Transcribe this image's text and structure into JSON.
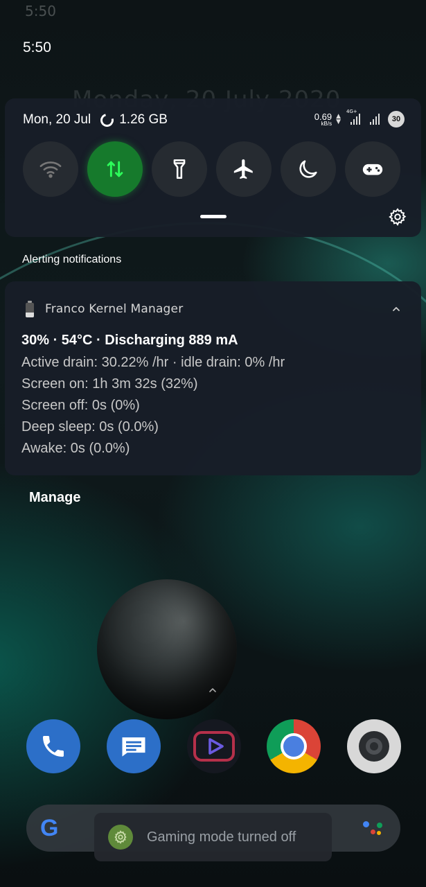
{
  "status_bar": {
    "ghost_time": "5:50",
    "time": "5:50"
  },
  "background": {
    "lockscreen_date": "Monday, 20 July 2020"
  },
  "quick_settings": {
    "date": "Mon, 20 Jul",
    "memory": "1.26 GB",
    "net_speed": "0.69",
    "net_speed_unit": "kB/s",
    "network_type": "4G+",
    "battery_level": "30",
    "tiles": [
      {
        "name": "wifi",
        "icon": "wifi-icon",
        "active": false
      },
      {
        "name": "mobile-data",
        "icon": "data-arrows-icon",
        "active": true
      },
      {
        "name": "flashlight",
        "icon": "flashlight-icon",
        "active": false
      },
      {
        "name": "airplane-mode",
        "icon": "airplane-icon",
        "active": false
      },
      {
        "name": "night-mode",
        "icon": "moon-icon",
        "active": false
      },
      {
        "name": "gaming-mode",
        "icon": "gamepad-icon",
        "active": false
      }
    ],
    "accent_color": "#167a2c"
  },
  "notifications": {
    "section_header": "Alerting notifications",
    "card": {
      "app_name": "Franco Kernel Manager",
      "title": "30% · 54°C · Discharging 889 mA",
      "lines": [
        "Active drain: 30.22% /hr · idle drain: 0% /hr",
        "Screen on: 1h 3m 32s  (32%)",
        "Screen off: 0s (0%)",
        "Deep sleep: 0s (0.0%)",
        "Awake: 0s (0.0%)"
      ]
    },
    "manage_label": "Manage"
  },
  "dock": {
    "apps": [
      "phone",
      "messages",
      "youtube-vanced",
      "chrome",
      "camera"
    ]
  },
  "toast": {
    "text": "Gaming mode turned off"
  },
  "search_bar": {
    "logo": "G"
  }
}
